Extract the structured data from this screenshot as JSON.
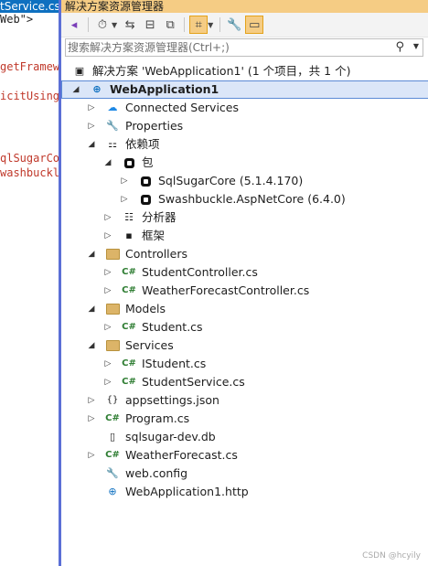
{
  "editor": {
    "tab": "tService.cs",
    "lines": [
      "Web\">",
      "getFramewo",
      "icitUsings",
      "qlSugarCor",
      "washbuckle"
    ]
  },
  "panel": {
    "title": "解决方案资源管理器",
    "search_placeholder": "搜索解决方案资源管理器(Ctrl+;)",
    "solution": "解决方案 'WebApplication1' (1 个项目，共 1 个)",
    "project": "WebApplication1",
    "items": [
      {
        "label": "Connected Services",
        "icon": "cloud-icon"
      },
      {
        "label": "Properties",
        "icon": "wrench-icon"
      },
      {
        "label": "依赖项",
        "icon": "dependencies-icon"
      },
      {
        "label": "包",
        "icon": "package-icon"
      },
      {
        "label": "SqlSugarCore (5.1.4.170)",
        "icon": "package-icon"
      },
      {
        "label": "Swashbuckle.AspNetCore (6.4.0)",
        "icon": "package-icon"
      },
      {
        "label": "分析器",
        "icon": "analyzer-icon"
      },
      {
        "label": "框架",
        "icon": "framework-icon"
      },
      {
        "label": "Controllers",
        "icon": "folder-icon"
      },
      {
        "label": "StudentController.cs",
        "icon": "csharp-icon"
      },
      {
        "label": "WeatherForecastController.cs",
        "icon": "csharp-icon"
      },
      {
        "label": "Models",
        "icon": "folder-icon"
      },
      {
        "label": "Student.cs",
        "icon": "csharp-icon"
      },
      {
        "label": "Services",
        "icon": "folder-icon"
      },
      {
        "label": "IStudent.cs",
        "icon": "csharp-icon"
      },
      {
        "label": "StudentService.cs",
        "icon": "csharp-icon"
      },
      {
        "label": "appsettings.json",
        "icon": "json-icon"
      },
      {
        "label": "Program.cs",
        "icon": "csharp-icon"
      },
      {
        "label": "sqlsugar-dev.db",
        "icon": "file-icon"
      },
      {
        "label": "WeatherForecast.cs",
        "icon": "csharp-icon"
      },
      {
        "label": "web.config",
        "icon": "config-icon"
      },
      {
        "label": "WebApplication1.http",
        "icon": "http-icon"
      }
    ],
    "csharp_glyph": "C#"
  },
  "watermark": "CSDN @hcyily",
  "colors": {
    "title_bar": "#f5cc84",
    "selection": "#dbe6f8",
    "accent": "#0e70c0"
  }
}
